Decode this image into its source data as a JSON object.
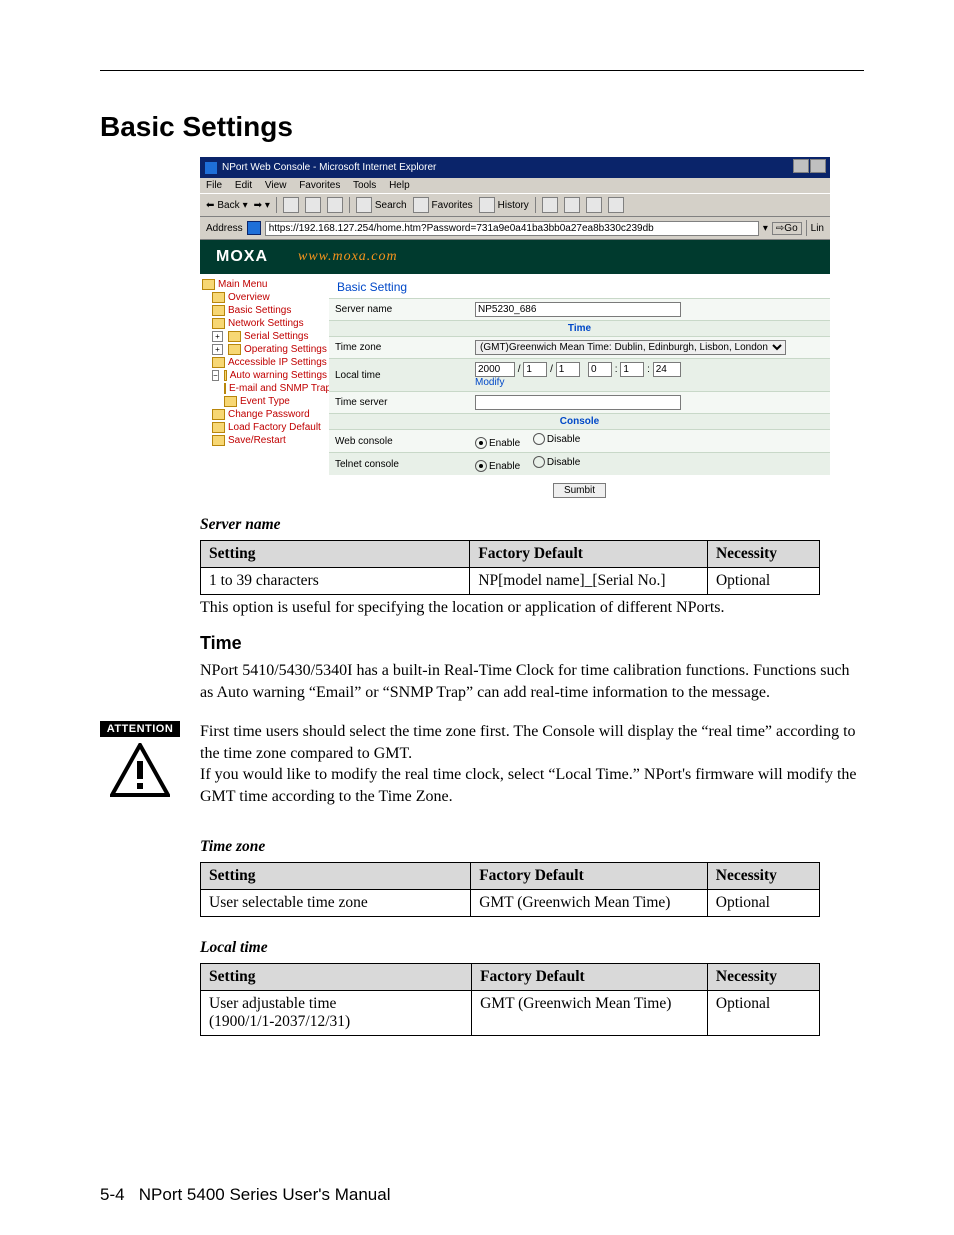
{
  "page": {
    "h1": "Basic Settings",
    "footer_left": "5-4",
    "footer_right": "NPort 5400 Series User's Manual"
  },
  "shot": {
    "title": "NPort Web Console - Microsoft Internet Explorer",
    "menubar": [
      "File",
      "Edit",
      "View",
      "Favorites",
      "Tools",
      "Help"
    ],
    "toolbar": {
      "back": "Back",
      "search": "Search",
      "favorites": "Favorites",
      "history": "History"
    },
    "address_label": "Address",
    "address_value": "https://192.168.127.254/home.htm?Password=731a9e0a41ba3bb0a27ea8b330c239db",
    "go": "Go",
    "links": "Lin",
    "logo": "MOXA",
    "brand_url": "www.moxa.com",
    "nav": {
      "root": "Main Menu",
      "overview": "Overview",
      "basic": "Basic Settings",
      "network": "Network Settings",
      "serial": "Serial Settings",
      "operating": "Operating Settings",
      "accessible": "Accessible IP Settings",
      "autowarn": "Auto warning Settings",
      "email": "E-mail and SNMP Trap",
      "eventtype": "Event Type",
      "changepw": "Change Password",
      "loadfactory": "Load Factory Default",
      "saverestart": "Save/Restart"
    },
    "content": {
      "title": "Basic Setting",
      "server_name_lbl": "Server name",
      "server_name_val": "NP5230_686",
      "time_hdr": "Time",
      "timezone_lbl": "Time zone",
      "timezone_val": "(GMT)Greenwich Mean Time: Dublin, Edinburgh, Lisbon, London",
      "localtime_lbl": "Local time",
      "lt_y": "2000",
      "lt_m": "1",
      "lt_d": "1",
      "lt_h": "0",
      "lt_min": "1",
      "lt_s": "24",
      "modify": "Modify",
      "timeserver_lbl": "Time server",
      "timeserver_val": "",
      "console_hdr": "Console",
      "web_lbl": "Web console",
      "telnet_lbl": "Telnet console",
      "enable": "Enable",
      "disable": "Disable",
      "submit": "Sumbit"
    }
  },
  "server_name": {
    "caption": "Server name",
    "h_setting": "Setting",
    "h_default": "Factory Default",
    "h_necessity": "Necessity",
    "setting": "1 to 39 characters",
    "default": "NP[model name]_[Serial No.]",
    "necessity": "Optional",
    "note": "This option is useful for specifying the location or application of different NPorts."
  },
  "time": {
    "h3": "Time",
    "para": "NPort 5410/5430/5340I has a built-in Real-Time Clock for time calibration functions. Functions such as Auto warning “Email” or “SNMP Trap” can add real-time information to the message."
  },
  "attention": {
    "label": "ATTENTION",
    "p1": "First time users should select the time zone first. The Console will display the “real time” according to the time zone compared to GMT.",
    "p2": "If you would like to modify the real time clock, select “Local Time.” NPort's firmware will modify the GMT time according to the Time Zone."
  },
  "timezone": {
    "caption": "Time zone",
    "h_setting": "Setting",
    "h_default": "Factory Default",
    "h_necessity": "Necessity",
    "setting": "User selectable time zone",
    "default": "GMT (Greenwich Mean Time)",
    "necessity": "Optional"
  },
  "localtime": {
    "caption": "Local time",
    "h_setting": "Setting",
    "h_default": "Factory Default",
    "h_necessity": "Necessity",
    "setting": "User adjustable time\n(1900/1/1-2037/12/31)",
    "default": "GMT (Greenwich Mean Time)",
    "necessity": "Optional"
  }
}
